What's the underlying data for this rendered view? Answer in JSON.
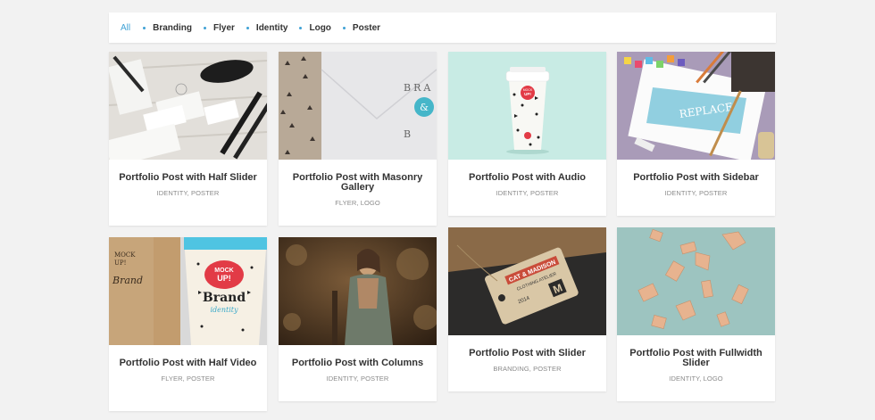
{
  "filters": [
    {
      "label": "All",
      "active": true
    },
    {
      "label": "Branding",
      "active": false
    },
    {
      "label": "Flyer",
      "active": false
    },
    {
      "label": "Identity",
      "active": false
    },
    {
      "label": "Logo",
      "active": false
    },
    {
      "label": "Poster",
      "active": false
    }
  ],
  "colors": {
    "accent": "#3fa1d5",
    "background": "#f2f2f2",
    "card": "#ffffff",
    "title": "#333333",
    "meta": "#8a8a8a"
  },
  "portfolio": [
    {
      "title": "Portfolio Post with Half Slider",
      "categories": "IDENTITY, POSTER",
      "image": "stationery-mockup-image"
    },
    {
      "title": "Portfolio Post with Masonry Gallery",
      "categories": "FLYER, LOGO",
      "image": "envelope-mockup-image"
    },
    {
      "title": "Portfolio Post with Audio",
      "categories": "IDENTITY, POSTER",
      "image": "coffee-cup-mockup-image"
    },
    {
      "title": "Portfolio Post with Sidebar",
      "categories": "IDENTITY, POSTER",
      "image": "watercolor-desk-image"
    },
    {
      "title": "Portfolio Post with Half Video",
      "categories": "FLYER, POSTER",
      "image": "brand-cup-mockup-image"
    },
    {
      "title": "Portfolio Post with Columns",
      "categories": "IDENTITY, POSTER",
      "image": "woman-portrait-image"
    },
    {
      "title": "Portfolio Post with Slider",
      "categories": "BRANDING, POSTER",
      "image": "clothing-tag-image"
    },
    {
      "title": "Portfolio Post with Fullwidth Slider",
      "categories": "IDENTITY, LOGO",
      "image": "wooden-blocks-image"
    }
  ],
  "image_text": {
    "envelope_1": "BRA",
    "envelope_2": "B",
    "cup_1": "MOCK",
    "cup_2": "UP!",
    "sidebar_1": "REPLACE",
    "brandcup_1": "MOCK",
    "brandcup_2": "UP!",
    "brandcup_3": "Brand",
    "brandcup_4": "identity",
    "tag_1": "CAT & MADISON",
    "tag_2": "CLOTHING ATELIER",
    "tag_3": "2014",
    "tag_4": "M"
  }
}
